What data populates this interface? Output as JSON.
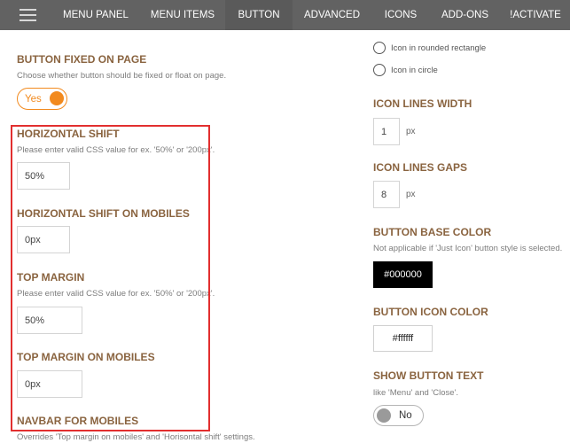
{
  "nav": {
    "tabs": [
      "MENU PANEL",
      "MENU ITEMS",
      "BUTTON",
      "ADVANCED",
      "ICONS",
      "ADD-ONS",
      "!ACTIVATE"
    ],
    "active_tab": "BUTTON"
  },
  "left": {
    "button_fixed": {
      "title": "BUTTON FIXED ON PAGE",
      "desc": "Choose whether button should be fixed or float on page.",
      "toggle_label": "Yes"
    },
    "horizontal_shift": {
      "title": "HORIZONTAL SHIFT",
      "desc": "Please enter valid CSS value for ex. '50%' or '200px'.",
      "value": "50%"
    },
    "horizontal_shift_mobiles": {
      "title": "HORIZONTAL SHIFT ON MOBILES",
      "value": "0px"
    },
    "top_margin": {
      "title": "TOP MARGIN",
      "desc": "Please enter valid CSS value for ex. '50%' or '200px'.",
      "value": "50%"
    },
    "top_margin_mobiles": {
      "title": "TOP MARGIN ON MOBILES",
      "value": "0px"
    },
    "navbar_mobiles": {
      "title": "NAVBAR FOR MOBILES",
      "desc": "Overrides 'Top margin on mobiles' and 'Horisontal shift' settings."
    }
  },
  "right": {
    "icon_style_options": [
      "Icon in rounded rectangle",
      "Icon in circle"
    ],
    "icon_lines_width": {
      "title": "ICON LINES WIDTH",
      "value": "1",
      "unit": "px"
    },
    "icon_lines_gaps": {
      "title": "ICON LINES GAPS",
      "value": "8",
      "unit": "px"
    },
    "button_base_color": {
      "title": "BUTTON BASE COLOR",
      "desc": "Not applicable if 'Just Icon' button style is selected.",
      "value": "#000000"
    },
    "button_icon_color": {
      "title": "BUTTON ICON COLOR",
      "value": "#ffffff"
    },
    "show_button_text": {
      "title": "SHOW BUTTON TEXT",
      "desc": "like 'Menu' and 'Close'.",
      "toggle_label": "No"
    }
  },
  "colors": {
    "topbar": "#626262",
    "section_title": "#8a6440",
    "accent": "#f28a1e",
    "highlight_box": "#e22f2f"
  }
}
